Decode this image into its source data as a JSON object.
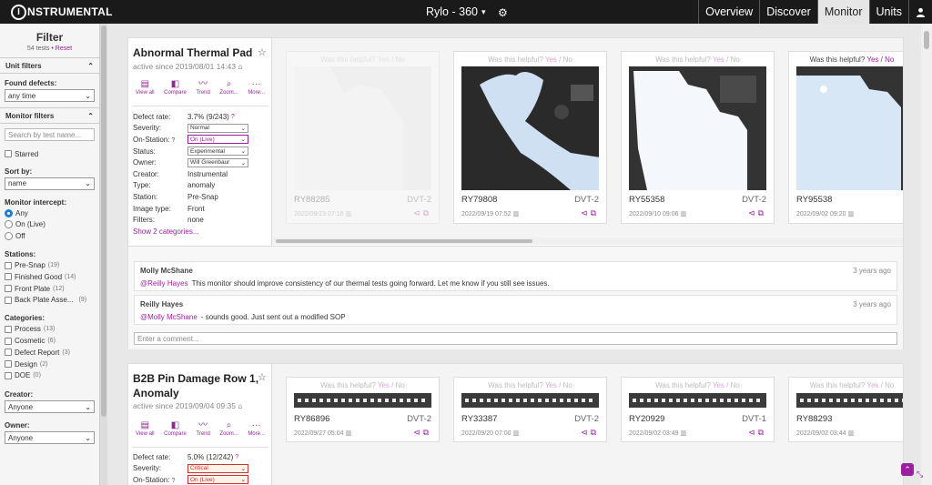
{
  "brand": {
    "logo_letter": "I",
    "logo_text": "NSTRUMENTAL"
  },
  "header": {
    "project": "Rylo - 360",
    "project_caret": "▾",
    "gear_icon": "⚙"
  },
  "nav": [
    {
      "label": "Overview",
      "active": false
    },
    {
      "label": "Discover",
      "active": false
    },
    {
      "label": "Monitor",
      "active": true
    },
    {
      "label": "Units",
      "active": false
    }
  ],
  "user_icon": "👤",
  "filter": {
    "title": "Filter",
    "tests_count": "54 tests",
    "separator": "•",
    "reset": "Reset",
    "unit_filters": "Unit filters",
    "found_defects_label": "Found defects:",
    "found_defects_value": "any time",
    "monitor_filters": "Monitor filters",
    "search_placeholder": "Search by test name...",
    "starred": "Starred",
    "sort_by_label": "Sort by:",
    "sort_by_value": "name",
    "intercept_label": "Monitor intercept:",
    "intercept_options": [
      {
        "label": "Any",
        "selected": true
      },
      {
        "label": "On (Live)",
        "selected": false
      },
      {
        "label": "Off",
        "selected": false
      }
    ],
    "stations_label": "Stations:",
    "stations": [
      {
        "label": "Pre-Snap",
        "count": "(19)"
      },
      {
        "label": "Finished Good",
        "count": "(14)"
      },
      {
        "label": "Front Plate",
        "count": "(12)"
      },
      {
        "label": "Back Plate Asse...",
        "count": "(9)"
      }
    ],
    "categories_label": "Categories:",
    "categories": [
      {
        "label": "Process",
        "count": "(13)"
      },
      {
        "label": "Cosmetic",
        "count": "(6)"
      },
      {
        "label": "Defect Report",
        "count": "(3)"
      },
      {
        "label": "Design",
        "count": "(2)"
      },
      {
        "label": "DOE",
        "count": "(0)"
      }
    ],
    "creator_label": "Creator:",
    "creator_value": "Anyone",
    "owner_label": "Owner:",
    "owner_value": "Anyone"
  },
  "actions": [
    {
      "label": "View all",
      "icon": "▤"
    },
    {
      "label": "Compare",
      "icon": "◧"
    },
    {
      "label": "Trend",
      "icon": "〰"
    },
    {
      "label": "Zoom...",
      "icon": "⌕"
    },
    {
      "label": "More...",
      "icon": "···"
    }
  ],
  "helpful": {
    "question": "Was this helpful?",
    "yes": "Yes",
    "sep": "/",
    "no": "No"
  },
  "monitors": [
    {
      "title": "Abnormal Thermal Pad",
      "star": "☆",
      "since": "active since 2019/08/01 14:43",
      "home_icon": "⌂",
      "defect_rate_label": "Defect rate:",
      "defect_rate": "3.7% (9/243)",
      "severity_label": "Severity:",
      "severity": "Normal",
      "on_station_label": "On-Station:",
      "on_station": "On (Live)",
      "status_label": "Status:",
      "status": "Experimental",
      "owner_label": "Owner:",
      "owner": "Will Greenbaur",
      "creator_label": "Creator:",
      "creator": "Instrumental",
      "type_label": "Type:",
      "type": "anomaly",
      "station_label": "Station:",
      "station": "Pre-Snap",
      "image_type_label": "Image type:",
      "image_type": "Front",
      "filters_label": "Filters:",
      "filters": "none",
      "categories_link": "Show 2 categories...",
      "units": [
        {
          "serial": "RY88285",
          "phase": "DVT-2",
          "date": "2022/09/23 07:16"
        },
        {
          "serial": "RY79808",
          "phase": "DVT-2",
          "date": "2022/09/19 07:52"
        },
        {
          "serial": "RY55358",
          "phase": "DVT-2",
          "date": "2022/09/10 09:06"
        },
        {
          "serial": "RY95538",
          "phase": "",
          "date": "2022/09/02 09:20"
        }
      ],
      "comments": [
        {
          "author": "Molly McShane",
          "time": "3 years ago",
          "mention": "@Reilly Hayes",
          "text": "This monitor should improve consistency of our thermal tests going forward. Let me know if you still see issues."
        },
        {
          "author": "Reilly Hayes",
          "time": "3 years ago",
          "mention": "@Molly McShane",
          "text": "- sounds good. Just sent out a modified SOP"
        }
      ],
      "comment_placeholder": "Enter a comment..."
    },
    {
      "title": "B2B Pin Damage Row 1, Anomaly",
      "star": "☆",
      "since": "active since 2019/09/04 09:35",
      "home_icon": "⌂",
      "defect_rate_label": "Defect rate:",
      "defect_rate": "5.0% (12/242)",
      "severity_label": "Severity:",
      "severity": "Critical",
      "on_station_label": "On-Station:",
      "on_station": "On (Live)",
      "units": [
        {
          "serial": "RY86896",
          "phase": "DVT-2",
          "date": "2022/09/27 05:04"
        },
        {
          "serial": "RY33387",
          "phase": "DVT-2",
          "date": "2022/09/20 07:00"
        },
        {
          "serial": "RY20929",
          "phase": "DVT-1",
          "date": "2022/09/02 03:49"
        },
        {
          "serial": "RY88293",
          "phase": "",
          "date": "2022/09/02 03:44"
        }
      ]
    }
  ],
  "icons": {
    "chevron_down": "⌄",
    "chevron_up": "⌃",
    "unit_icon": "▥",
    "tag_icon": "⊲",
    "copy_icon": "⧉",
    "info": "?"
  },
  "accent_color": "#9c1fa0"
}
